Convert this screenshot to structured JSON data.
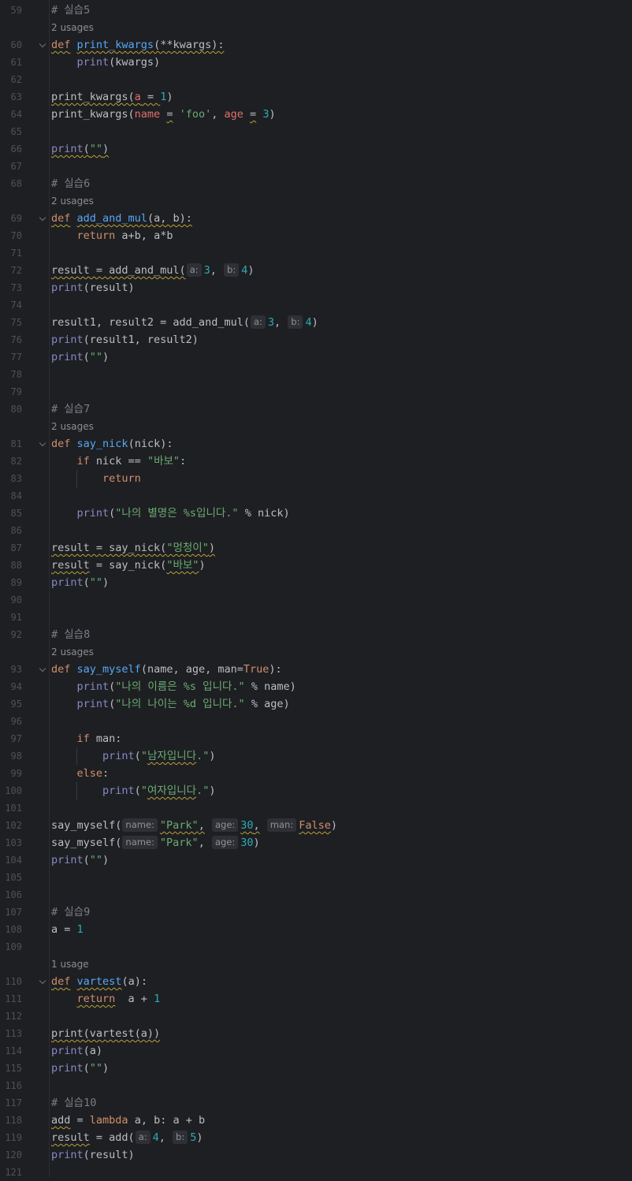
{
  "editor": {
    "top_notice": "",
    "lines": [
      {
        "n": "59",
        "html": "<span class='cmt'># 실습5</span>"
      },
      {
        "usage": "2 usages"
      },
      {
        "n": "60",
        "fold": true,
        "html": "<span class='kw warn'>def</span> <span class='fn warn'>print_kwargs</span><span class='warn'>(**kwargs):</span>"
      },
      {
        "n": "61",
        "html": "    <span class='bi'>print</span>(kwargs)"
      },
      {
        "n": "62",
        "html": ""
      },
      {
        "n": "63",
        "html": "<span class='warn'>print_kwargs(</span><span class='param warn'>a</span><span class='warn'> = </span><span class='num'>1</span>)"
      },
      {
        "n": "64",
        "html": "print_kwargs(<span class='param'>name</span> <span class='warn'>=</span> <span class='str'>'foo'</span>, <span class='param'>age</span> <span class='warn'>=</span> <span class='num'>3</span>)"
      },
      {
        "n": "65",
        "html": ""
      },
      {
        "n": "66",
        "html": "<span class='bi warn'>print</span><span class='warn'>(</span><span class='str warn'>\"\"</span><span class='warn'>)</span>"
      },
      {
        "n": "67",
        "html": ""
      },
      {
        "n": "68",
        "html": "<span class='cmt'># 실습6</span>"
      },
      {
        "usage": "2 usages"
      },
      {
        "n": "69",
        "fold": true,
        "html": "<span class='kw warn'>def</span> <span class='fn warn'>add_and_mul</span><span class='warn'>(a, b):</span>"
      },
      {
        "n": "70",
        "html": "    <span class='kw'>return</span> a+b, a*b"
      },
      {
        "n": "71",
        "html": ""
      },
      {
        "n": "72",
        "html": "<span class='warn'>result = add_and_mul(</span><span class='hint'>a:</span><span class='num'>3</span>, <span class='hint'>b:</span><span class='num'>4</span>)"
      },
      {
        "n": "73",
        "html": "<span class='bi'>print</span>(result)"
      },
      {
        "n": "74",
        "html": ""
      },
      {
        "n": "75",
        "html": "result1, result2 = add_and_mul(<span class='hint'>a:</span><span class='num'>3</span>, <span class='hint'>b:</span><span class='num'>4</span>)"
      },
      {
        "n": "76",
        "html": "<span class='bi'>print</span>(result1, result2)"
      },
      {
        "n": "77",
        "html": "<span class='bi'>print</span>(<span class='str'>\"\"</span>)"
      },
      {
        "n": "78",
        "html": ""
      },
      {
        "n": "79",
        "html": ""
      },
      {
        "n": "80",
        "html": "<span class='cmt'># 실습7</span>"
      },
      {
        "usage": "2 usages"
      },
      {
        "n": "81",
        "fold": true,
        "html": "<span class='kw'>def</span> <span class='fn'>say_nick</span>(nick):"
      },
      {
        "n": "82",
        "html": "    <span class='kw'>if</span> nick == <span class='str'>\"바보\"</span>:"
      },
      {
        "n": "83",
        "html": "        <span class='kw'>return</span>"
      },
      {
        "n": "84",
        "html": ""
      },
      {
        "n": "85",
        "html": "    <span class='bi'>print</span>(<span class='str'>\"나의 별명은 %s입니다.\"</span> % nick)"
      },
      {
        "n": "86",
        "html": ""
      },
      {
        "n": "87",
        "html": "<span class='warn'>result = say_nick(</span><span class='str warn'>\"멍청이\"</span><span class='warn'>)</span>"
      },
      {
        "n": "88",
        "html": "<span class='warn'>result</span> = say_nick(<span class='str warn'>\"바보\"</span>)"
      },
      {
        "n": "89",
        "html": "<span class='bi'>print</span>(<span class='str'>\"\"</span>)"
      },
      {
        "n": "90",
        "html": ""
      },
      {
        "n": "91",
        "html": ""
      },
      {
        "n": "92",
        "html": "<span class='cmt'># 실습8</span>"
      },
      {
        "usage": "2 usages"
      },
      {
        "n": "93",
        "fold": true,
        "html": "<span class='kw'>def</span> <span class='fn'>say_myself</span>(name, age, man=<span class='kw'>True</span>):"
      },
      {
        "n": "94",
        "html": "    <span class='bi'>print</span>(<span class='str'>\"나의 이름은 %s 입니다.\"</span> % name)"
      },
      {
        "n": "95",
        "html": "    <span class='bi'>print</span>(<span class='str'>\"나의 나이는 %d 입니다.\"</span> % age)"
      },
      {
        "n": "96",
        "html": ""
      },
      {
        "n": "97",
        "html": "    <span class='kw'>if</span> man:"
      },
      {
        "n": "98",
        "html": "        <span class='bi'>print</span>(<span class='str'>\"<span class='warn'>남자입니다</span>.\"</span>)"
      },
      {
        "n": "99",
        "html": "    <span class='kw'>else</span>:"
      },
      {
        "n": "100",
        "html": "        <span class='bi'>print</span>(<span class='str'>\"<span class='warn'>여자입니다</span>.\"</span>)"
      },
      {
        "n": "101",
        "html": ""
      },
      {
        "n": "102",
        "html": "say_myself(<span class='hint'>name:</span><span class='str warn'>\"Park\"</span><span class='warn'>,</span> <span class='hint'>age:</span><span class='num warn'>30</span><span class='warn'>,</span> <span class='hint'>man:</span><span class='kw warn'>False</span>)"
      },
      {
        "n": "103",
        "html": "say_myself(<span class='hint'>name:</span><span class='str'>\"Park\"</span>, <span class='hint'>age:</span><span class='num'>30</span>)"
      },
      {
        "n": "104",
        "html": "<span class='bi'>print</span>(<span class='str'>\"\"</span>)"
      },
      {
        "n": "105",
        "html": ""
      },
      {
        "n": "106",
        "html": ""
      },
      {
        "n": "107",
        "html": "<span class='cmt'># 실습9</span>"
      },
      {
        "n": "108",
        "html": "a = <span class='num'>1</span>"
      },
      {
        "n": "109",
        "html": ""
      },
      {
        "usage": "1 usage"
      },
      {
        "n": "110",
        "fold": true,
        "html": "<span class='kw warn'>def</span> <span class='fn warn'>vartest</span>(a):"
      },
      {
        "n": "111",
        "html": "    <span class='kw warn'>return</span>  a + <span class='num'>1</span>"
      },
      {
        "n": "112",
        "html": ""
      },
      {
        "n": "113",
        "html": "<span class='warn'>print(vartest(a))</span>"
      },
      {
        "n": "114",
        "html": "<span class='bi'>print</span>(a)"
      },
      {
        "n": "115",
        "html": "<span class='bi'>print</span>(<span class='str'>\"\"</span>)"
      },
      {
        "n": "116",
        "html": ""
      },
      {
        "n": "117",
        "html": "<span class='cmt'># 실습10</span>"
      },
      {
        "n": "118",
        "html": "<span class='warn'>add</span> = <span class='kw'>lambda</span> a, b: a + b"
      },
      {
        "n": "119",
        "html": "<span class='warn'>result</span> = add(<span class='hint'>a:</span><span class='num'>4</span>, <span class='hint'>b:</span><span class='num'>5</span>)"
      },
      {
        "n": "120",
        "html": "<span class='bi'>print</span>(result)"
      },
      {
        "n": "121",
        "html": ""
      }
    ]
  },
  "colors": {
    "background": "#1e1f22",
    "keyword": "#cf8e6d",
    "function": "#56a8f5",
    "string": "#6aab73",
    "number": "#2aacb8",
    "comment": "#7a7e85",
    "builtin": "#8888c6",
    "param": "#e0706b",
    "warning_underline": "#b9a13a"
  }
}
